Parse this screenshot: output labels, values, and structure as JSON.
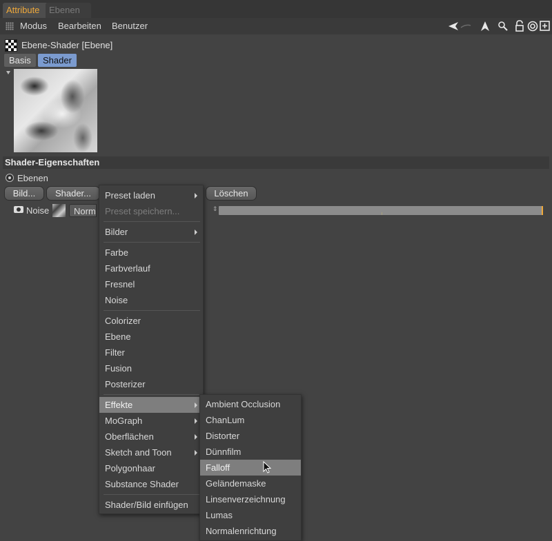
{
  "tabs": [
    {
      "label": "Attribute",
      "active": true
    },
    {
      "label": "Ebenen",
      "active": false
    }
  ],
  "menubar": {
    "items": [
      "Modus",
      "Bearbeiten",
      "Benutzer"
    ],
    "tool_icons": [
      "back-arrow-icon",
      "forward-arrow-icon",
      "up-arrow-icon",
      "search-icon",
      "lock-icon",
      "target-icon",
      "new-panel-icon"
    ]
  },
  "object_title": "Ebene-Shader [Ebene]",
  "subtabs": [
    "Basis",
    "Shader"
  ],
  "active_subtab": "Shader",
  "section_title": "Shader-Eigenschaften",
  "radio_label": "Ebenen",
  "buttons": {
    "bild": "Bild...",
    "shader": "Shader...",
    "loeschen": "Löschen"
  },
  "layer": {
    "name": "Noise",
    "blend_mode": "Normal"
  },
  "dropdown": {
    "items": [
      {
        "label": "Preset laden",
        "submenu": true,
        "disabled": false
      },
      {
        "label": "Preset speichern...",
        "submenu": false,
        "disabled": true
      },
      {
        "label": "Bilder",
        "submenu": true,
        "disabled": false
      },
      {
        "label": "Farbe",
        "submenu": false,
        "disabled": false
      },
      {
        "label": "Farbverlauf",
        "submenu": false,
        "disabled": false
      },
      {
        "label": "Fresnel",
        "submenu": false,
        "disabled": false
      },
      {
        "label": "Noise",
        "submenu": false,
        "disabled": false
      },
      {
        "label": "Colorizer",
        "submenu": false,
        "disabled": false
      },
      {
        "label": "Ebene",
        "submenu": false,
        "disabled": false
      },
      {
        "label": "Filter",
        "submenu": false,
        "disabled": false
      },
      {
        "label": "Fusion",
        "submenu": false,
        "disabled": false
      },
      {
        "label": "Posterizer",
        "submenu": false,
        "disabled": false
      },
      {
        "label": "Effekte",
        "submenu": true,
        "highlight": true
      },
      {
        "label": "MoGraph",
        "submenu": true,
        "disabled": false
      },
      {
        "label": "Oberflächen",
        "submenu": true,
        "disabled": false
      },
      {
        "label": "Sketch and Toon",
        "submenu": true,
        "disabled": false
      },
      {
        "label": "Polygonhaar",
        "submenu": false,
        "disabled": false
      },
      {
        "label": "Substance Shader",
        "submenu": false,
        "disabled": false
      },
      {
        "label": "Shader/Bild einfügen",
        "submenu": false,
        "disabled": false
      }
    ]
  },
  "submenu": {
    "items": [
      "Ambient Occlusion",
      "ChanLum",
      "Distorter",
      "Dünnfilm",
      "Falloff",
      "Geländemaske",
      "Linsenverzeichnung",
      "Lumas",
      "Normalenrichtung"
    ],
    "highlighted": "Falloff"
  }
}
